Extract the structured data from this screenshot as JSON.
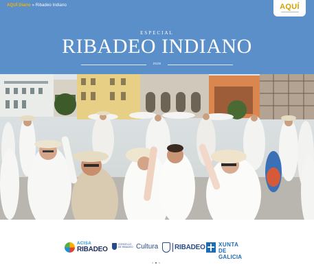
{
  "header": {
    "breadcrumb_brand": "AQUÍ Diario",
    "breadcrumb_sep": "»",
    "breadcrumb_page": "Ribadeo Indiano",
    "logo_text": "AQUÍ",
    "especial": "ESPECIAL",
    "title": "RIBADEO INDIANO",
    "year": "2025",
    "bg_color": "#5b8fc9",
    "accent_color": "#f7b500"
  },
  "hero": {
    "image": "photo-people-dancing-in-white-clothes-and-hats"
  },
  "sponsors": {
    "acisa_top": "ACISA",
    "acisa_bottom": "RIBADEO",
    "cultura_small": "CONCELLO DE RIBADEO",
    "cultura_word": "Cultura",
    "ribadeo_word": "RIBADEO",
    "xunta_line1": "XUNTA",
    "xunta_line2": "DE GALICIA"
  },
  "pager": {
    "count": 3,
    "active": 2
  }
}
